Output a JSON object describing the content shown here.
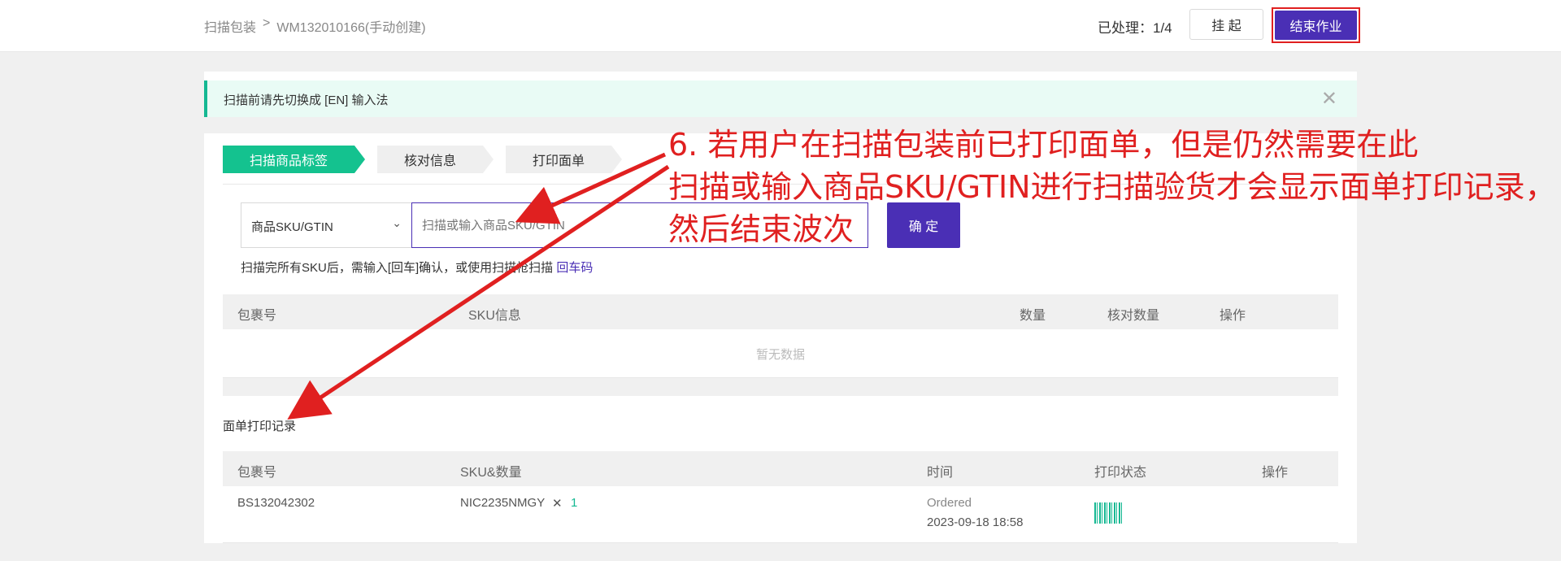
{
  "breadcrumb": {
    "root": "扫描包装",
    "separator": ">",
    "current": "WM132010166(手动创建)"
  },
  "header": {
    "processed_label": "已处理：1/4",
    "hang_button": "挂 起",
    "finish_button": "结束作业"
  },
  "notice": {
    "text": "扫描前请先切换成 [EN] 输入法",
    "close": "✕"
  },
  "steps": [
    "扫描商品标签",
    "核对信息",
    "打印面单"
  ],
  "scan": {
    "select_value": "商品SKU/GTIN",
    "input_placeholder": "扫描或输入商品SKU/GTIN",
    "confirm_button": "确 定",
    "hint_text": "扫描完所有SKU后，需输入[回车]确认，或使用扫描枪扫描 ",
    "hint_link": "回车码"
  },
  "sku_table": {
    "columns": [
      "包裹号",
      "SKU信息",
      "数量",
      "核对数量",
      "操作"
    ],
    "empty_text": "暂无数据"
  },
  "print_record": {
    "title": "面单打印记录",
    "columns": [
      "包裹号",
      "SKU&数量",
      "时间",
      "打印状态",
      "操作"
    ],
    "rows": [
      {
        "package": "BS132042302",
        "sku": "NIC2235NMGY",
        "times": "✕",
        "qty": "1",
        "status": "Ordered",
        "time": "2023-09-18 18:58"
      }
    ]
  },
  "annotation": {
    "line1": "6. 若用户在扫描包装前已打印面单，但是仍然需要在此",
    "line2": "扫描或输入商品SKU/GTIN进行扫描验货才会显示面单打印记录，",
    "line3": "然后结束波次"
  },
  "colors": {
    "primary": "#4a2fb5",
    "accent": "#14c28f",
    "annotation": "#e02020"
  }
}
